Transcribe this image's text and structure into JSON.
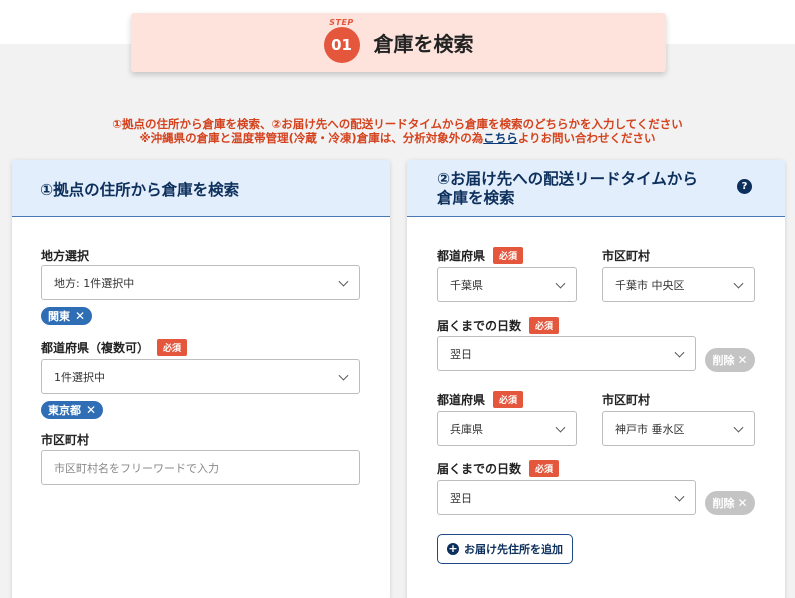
{
  "step": {
    "word": "STEP",
    "number": "01",
    "title": "倉庫を検索"
  },
  "notice": {
    "line1": "①拠点の住所から倉庫を検索、②お届け先への配送リードタイムから倉庫を検索のどちらかを入力してください",
    "line2_prefix": "※沖縄県の倉庫と温度帯管理(冷蔵・冷凍)倉庫は、分析対象外の為",
    "line2_link": "こちら",
    "line2_suffix": "よりお問い合わせください"
  },
  "left": {
    "title": "①拠点の住所から倉庫を検索",
    "region_label": "地方選択",
    "region_value": "地方: 1件選択中",
    "region_chip": "関東",
    "pref_label": "都道府県（複数可）",
    "required": "必須",
    "pref_value": "1件選択中",
    "pref_chip": "東京都",
    "city_label": "市区町村",
    "city_placeholder": "市区町村名をフリーワードで入力"
  },
  "right": {
    "title_line1": "②お届け先への配送リードタイムから",
    "title_line2": "倉庫を検索",
    "help": "?",
    "pref_label": "都道府県",
    "city_label": "市区町村",
    "days_label": "届くまでの日数",
    "required": "必須",
    "delete_label": "削除",
    "rows": [
      {
        "pref": "千葉県",
        "city": "千葉市 中央区",
        "days": "翌日"
      },
      {
        "pref": "兵庫県",
        "city": "神戸市 垂水区",
        "days": "翌日"
      }
    ],
    "add_label": "お届け先住所を追加"
  },
  "x_mark": "✕",
  "plus_mark": "+"
}
